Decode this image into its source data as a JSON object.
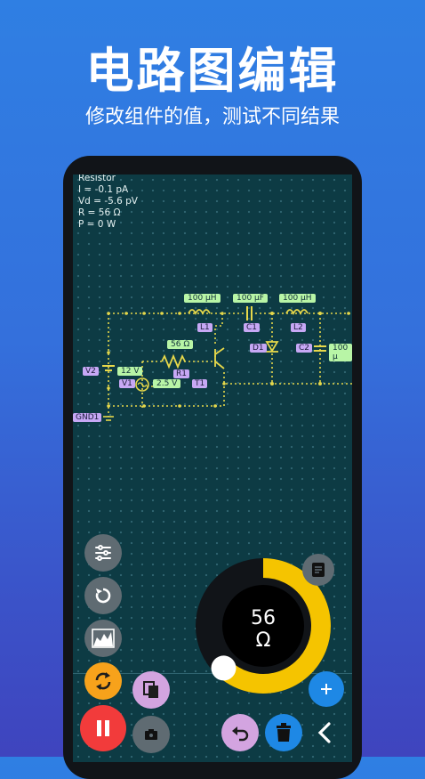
{
  "promo": {
    "title": "电路图编辑",
    "subtitle": "修改组件的值，测试不同结果"
  },
  "readout": {
    "component": "Resistor",
    "current": "I = -0.1 pA",
    "voltage": "Vd = -5.6 pV",
    "resistance": "R = 56 Ω",
    "power": "P = 0 W"
  },
  "circuit": {
    "values": {
      "l1": "100 μH",
      "c1": "100 μF",
      "l2": "100 μH",
      "r1": "56 Ω",
      "v2": "12 V",
      "v1": "2.5 V",
      "c2": "100 μ"
    },
    "names": {
      "l1": "L1",
      "c1": "C1",
      "l2": "L2",
      "d1": "D1",
      "c2": "C2",
      "r1": "R1",
      "v2": "V2",
      "v1": "V1",
      "t1": "T1",
      "gnd": "GND1"
    }
  },
  "knob": {
    "value": "56",
    "unit": "Ω",
    "level": 0.62,
    "accent": "#f5c400"
  },
  "colors": {
    "label_green": "#b8f5a6",
    "label_purple": "#c7a8f5",
    "wire": "#e6d84a",
    "fab_red": "#f23b3b",
    "fab_orange": "#f7a21b",
    "fab_blue": "#1e88e5",
    "fab_pink": "#d3a4e0"
  },
  "icons": [
    "sliders-icon",
    "reset-icon",
    "chart-icon",
    "cycle-icon",
    "pause-icon",
    "copy-icon",
    "camera-icon",
    "undo-icon",
    "trash-icon",
    "back-icon",
    "add-icon",
    "notes-icon"
  ]
}
